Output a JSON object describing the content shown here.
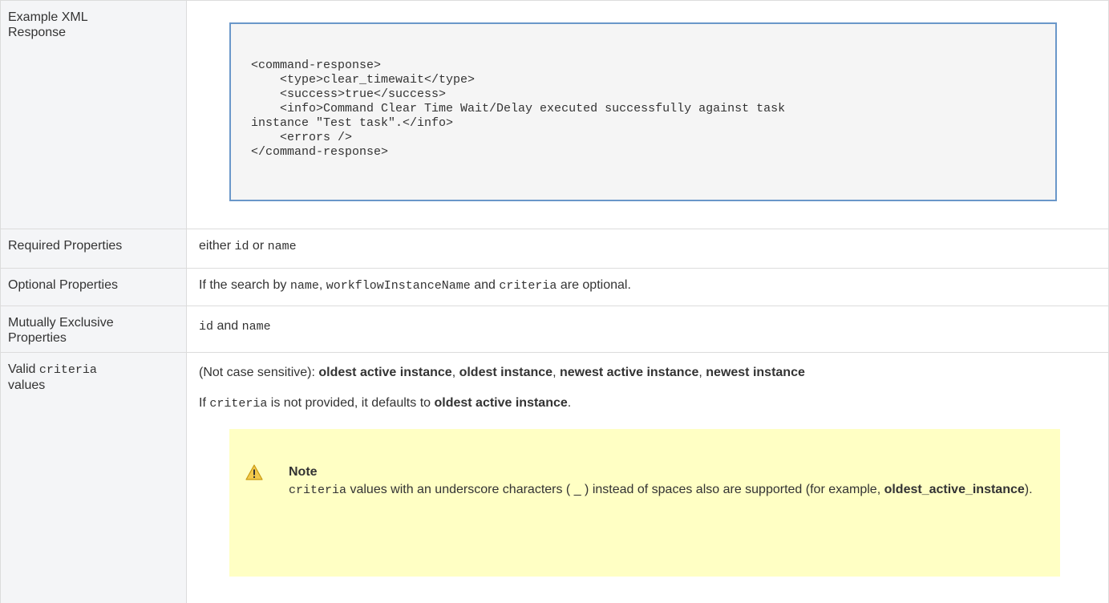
{
  "rows": {
    "xml": {
      "label": "Example XML Response",
      "code_lines": [
        "<command-response>",
        "    <type>clear_timewait</type>",
        "    <success>true</success>",
        "    <info>Command Clear Time Wait/Delay executed successfully against task",
        "instance \"Test task\".</info>",
        "    <errors />",
        "</command-response>"
      ]
    },
    "required": {
      "label": "Required Properties",
      "prefix": "either ",
      "code1": "id",
      "mid": " or ",
      "code2": "name"
    },
    "optional": {
      "label": "Optional Properties",
      "prefix": "If the search by ",
      "code1": "name",
      "sep1": ", ",
      "code2": "workflowInstanceName",
      "mid": " and ",
      "code3": "criteria",
      "suffix": " are optional."
    },
    "mutual": {
      "label_line1": "Mutually Exclusive",
      "label_line2": "Properties",
      "code1": "id",
      "mid": " and ",
      "code2": "name"
    },
    "valid": {
      "label_prefix": "Valid ",
      "label_code": "criteria",
      "label_suffix": "values",
      "p1_prefix": "(Not case sensitive): ",
      "opt1": "oldest active instance",
      "sep": ", ",
      "opt2": "oldest instance",
      "opt3": "newest active instance",
      "opt4": "newest instance",
      "p2_code": "criteria",
      "p2_mid": " is not provided, it defaults to ",
      "p2_if": "If ",
      "p2_bold": "oldest active instance",
      "p2_end": ".",
      "note": {
        "title": "Note",
        "code": "criteria",
        "text1": " values with an underscore characters ( _ ) instead of spaces also are supported (for example, ",
        "bold": "oldest_active_instance",
        "text2": ")."
      }
    }
  },
  "colors": {
    "label_bg": "#f4f5f7",
    "code_panel_border": "#6a97c9",
    "note_bg": "#ffffc4"
  },
  "icons": {
    "note": "warning-icon"
  }
}
